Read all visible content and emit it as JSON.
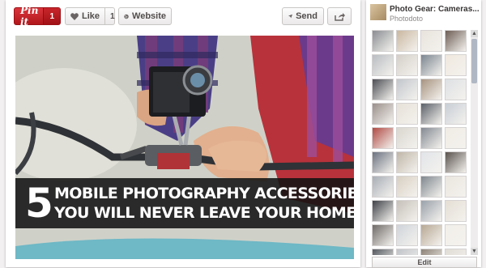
{
  "toolbar": {
    "pin_label": "Pin it",
    "pin_count": "1",
    "like_label": "Like",
    "like_count": "1",
    "website_label": "Website",
    "send_label": "Send"
  },
  "pin_image": {
    "number": "5",
    "headline_line1": "MOBILE PHOTOGRAPHY ACCESSORIES",
    "headline_line2": "YOU WILL NEVER LEAVE YOUR HOME WITHOUT"
  },
  "board": {
    "title": "Photo Gear: Cameras...",
    "user": "Photodoto",
    "edit_label": "Edit",
    "thumbnails": [
      "#8a8d92",
      "#c9b7a0",
      "#e8e3dc",
      "#6d5d55",
      "#b9bdc2",
      "#d4cfc8",
      "#7b8590",
      "#efe8de",
      "#4d4f55",
      "#c2c6cc",
      "#a79380",
      "#dde0e3",
      "#9a8f8a",
      "#e6e1d8",
      "#5b6068",
      "#c8ced6",
      "#b04a44",
      "#d9d6cf",
      "#848a93",
      "#f0ece5",
      "#6b7280",
      "#bfb6a8",
      "#e1e4e8",
      "#59524d",
      "#a8aeb6",
      "#d8cfc2",
      "#7f878f",
      "#eae6df",
      "#3f4248",
      "#c5c0b8",
      "#9aa1aa",
      "#e4ded4",
      "#6e6a67",
      "#cfd4da",
      "#b7a894",
      "#f2efe9",
      "#555a61",
      "#c0c4c9",
      "#8d8378",
      "#e0dcd6"
    ]
  },
  "colors": {
    "pin_red": "#c4222a",
    "banner_bg": "#121212"
  },
  "icons": {
    "pin_logo": "pinterest-logo",
    "like": "heart-icon",
    "website": "globe-icon",
    "send": "send-icon",
    "share": "share-icon",
    "scroll_up": "scroll-up-arrow",
    "scroll_down": "scroll-down-arrow"
  }
}
